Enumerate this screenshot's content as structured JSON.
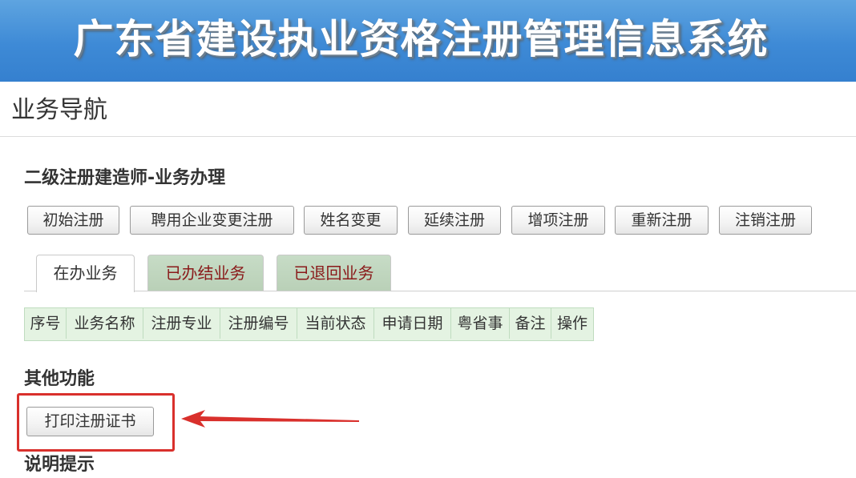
{
  "header": {
    "system_title": "广东省建设执业资格注册管理信息系统"
  },
  "nav": {
    "title": "业务导航"
  },
  "business_section": {
    "title": "二级注册建造师-业务办理",
    "buttons": [
      "初始注册",
      "聘用企业变更注册",
      "姓名变更",
      "延续注册",
      "增项注册",
      "重新注册",
      "注销注册"
    ]
  },
  "tabs": [
    {
      "label": "在办业务",
      "active": true
    },
    {
      "label": "已办结业务",
      "active": false
    },
    {
      "label": "已退回业务",
      "active": false
    }
  ],
  "table": {
    "columns": [
      "序号",
      "业务名称",
      "注册专业",
      "注册编号",
      "当前状态",
      "申请日期",
      "粤省事",
      "备注",
      "操作"
    ],
    "rows": []
  },
  "other_section": {
    "title": "其他功能",
    "print_button": "打印注册证书"
  },
  "notes_section": {
    "title": "说明提示"
  },
  "colors": {
    "banner": "#3e8ad6",
    "tab_inactive_bg": "#b9d0b7",
    "tab_inactive_text": "#8a1a1a",
    "table_header_bg": "#e4f3e2",
    "annotation": "#d9302c"
  }
}
